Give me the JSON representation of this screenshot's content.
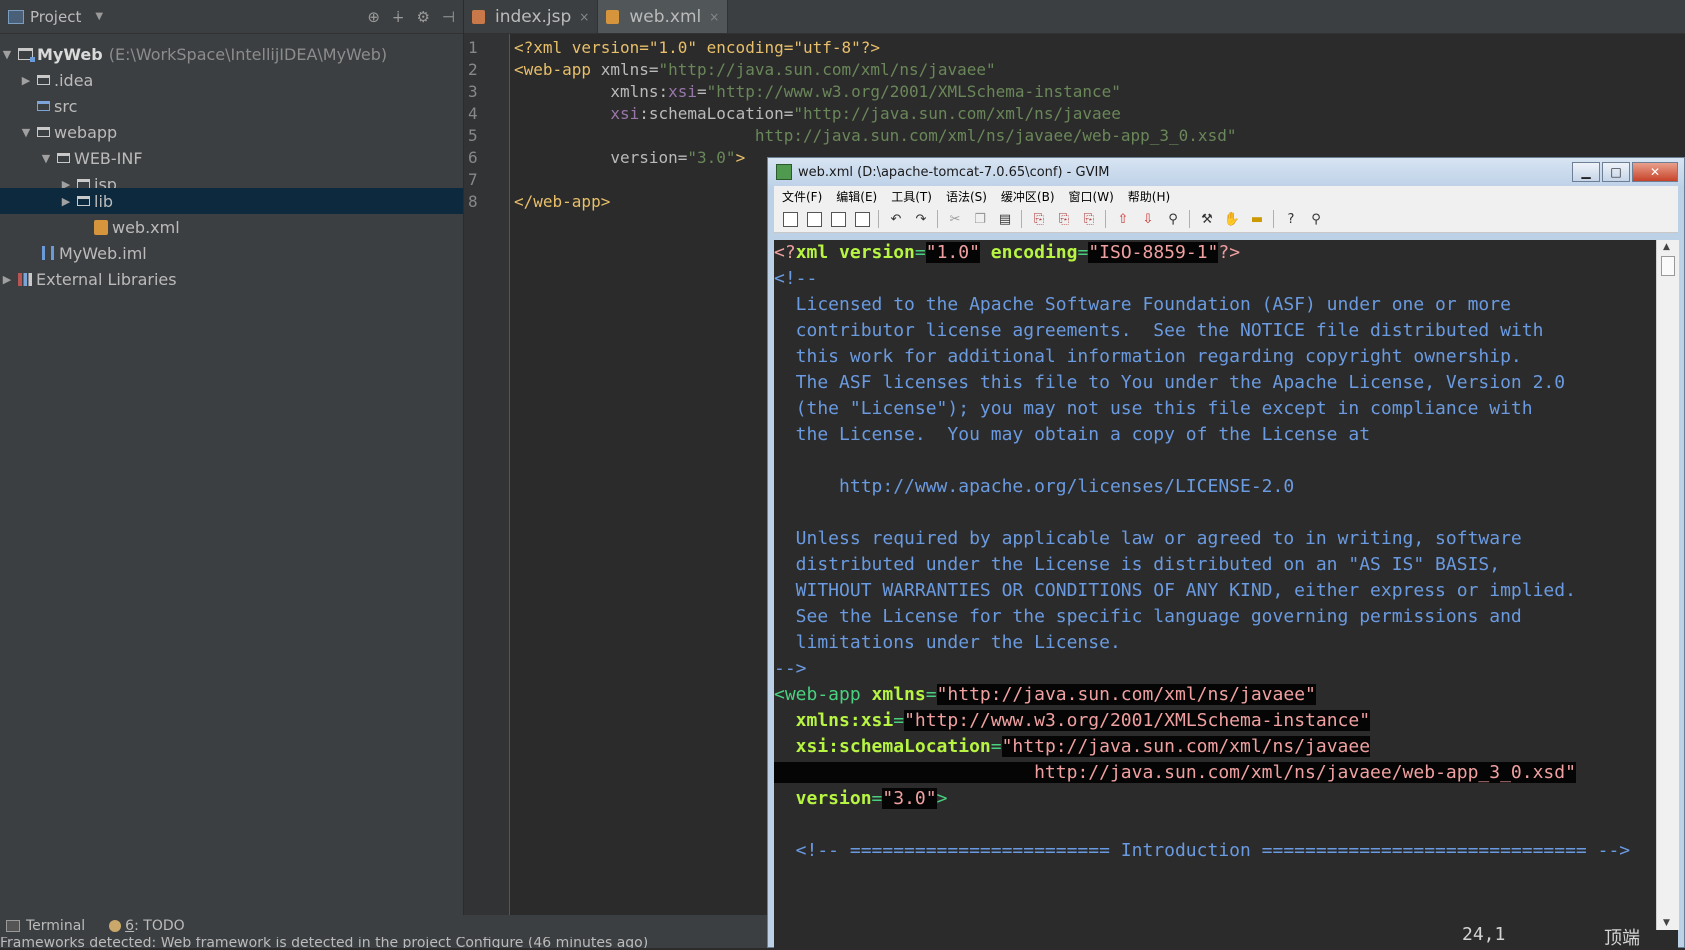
{
  "project_panel": {
    "header_label": "Project",
    "tree": [
      {
        "label": "MyWeb",
        "extra": "(E:\\WorkSpace\\IntellijIDEA\\MyWeb)"
      },
      {
        "label": ".idea"
      },
      {
        "label": "src"
      },
      {
        "label": "webapp"
      },
      {
        "label": "WEB-INF"
      },
      {
        "label": "jsp"
      },
      {
        "label": "lib"
      },
      {
        "label": "web.xml"
      },
      {
        "label": "MyWeb.iml"
      },
      {
        "label": "External Libraries"
      }
    ]
  },
  "editor": {
    "tabs": [
      {
        "label": "index.jsp"
      },
      {
        "label": "web.xml"
      }
    ],
    "line_numbers": [
      "1",
      "2",
      "3",
      "4",
      "5",
      "6",
      "7",
      "8"
    ],
    "lines": {
      "l1": "<?xml version=\"1.0\" encoding=\"utf-8\"?>",
      "l2_tag": "<web-app",
      "l2_attr": " xmlns=",
      "l2_val": "\"http://java.sun.com/xml/ns/javaee\"",
      "l3_attr": "          xmlns:",
      "l3_ns": "xsi",
      "l3_eq": "=",
      "l3_val": "\"http://www.w3.org/2001/XMLSchema-instance\"",
      "l4_ns": "          xsi",
      "l4_attr": ":schemaLocation=",
      "l4_val": "\"http://java.sun.com/xml/ns/javaee",
      "l5_val": "                         http://java.sun.com/xml/ns/javaee/web-app_3_0.xsd\"",
      "l6_attr": "          version=",
      "l6_val": "\"3.0\"",
      "l6_tag": ">",
      "l8": "</web-app>"
    }
  },
  "gvim": {
    "title": "web.xml (D:\\apache-tomcat-7.0.65\\conf) - GVIM",
    "menu": [
      "文件(F)",
      "编辑(E)",
      "工具(T)",
      "语法(S)",
      "缓冲区(B)",
      "窗口(W)",
      "帮助(H)"
    ],
    "text": {
      "v1_pi_open": "<?",
      "v1_tag": "xml",
      "v1_attr1": " version",
      "v1_eq1": "=",
      "v1_val1": "\"1.0\"",
      "v1_attr2": " encoding",
      "v1_eq2": "=",
      "v1_val2": "\"ISO-8859-1\"",
      "v1_pi_close": "?>",
      "v2": "<!--",
      "v3": "  Licensed to the Apache Software Foundation (ASF) under one or more",
      "v4": "  contributor license agreements.  See the NOTICE file distributed with",
      "v5": "  this work for additional information regarding copyright ownership.",
      "v6": "  The ASF licenses this file to You under the Apache License, Version 2.0",
      "v7": "  (the \"License\"); you may not use this file except in compliance with",
      "v8": "  the License.  You may obtain a copy of the License at",
      "v10": "      http://www.apache.org/licenses/LICENSE-2.0",
      "v12": "  Unless required by applicable law or agreed to in writing, software",
      "v13": "  distributed under the License is distributed on an \"AS IS\" BASIS,",
      "v14": "  WITHOUT WARRANTIES OR CONDITIONS OF ANY KIND, either express or implied.",
      "v15": "  See the License for the specific language governing permissions and",
      "v16": "  limitations under the License.",
      "v17": "-->",
      "v18_tag": "<web-app",
      "v18_attr": " xmlns",
      "v18_eq": "=",
      "v18_val": "\"http://java.sun.com/xml/ns/javaee\"",
      "v19_attr": "  xmlns:xsi",
      "v19_eq": "=",
      "v19_val": "\"http://www.w3.org/2001/XMLSchema-instance\"",
      "v20_attr": "  xsi:schemaLocation",
      "v20_eq": "=",
      "v20_val": "\"http://java.sun.com/xml/ns/javaee",
      "v21_pad": "                    ",
      "v21_val": "    http://java.sun.com/xml/ns/javaee/web-app_3_0.xsd\"",
      "v22_attr": "  version",
      "v22_eq": "=",
      "v22_val": "\"3.0\"",
      "v22_tag": ">",
      "v24": "  <!-- ======================== Introduction ============================== -->"
    },
    "status": {
      "position": "24,1",
      "scroll": "顶端"
    }
  },
  "bottom_bar": {
    "terminal": "Terminal",
    "todo_num": "6",
    "todo_label": ": TODO",
    "status_message": "Frameworks detected: Web framework is detected in the project Configure (46 minutes ago)"
  }
}
